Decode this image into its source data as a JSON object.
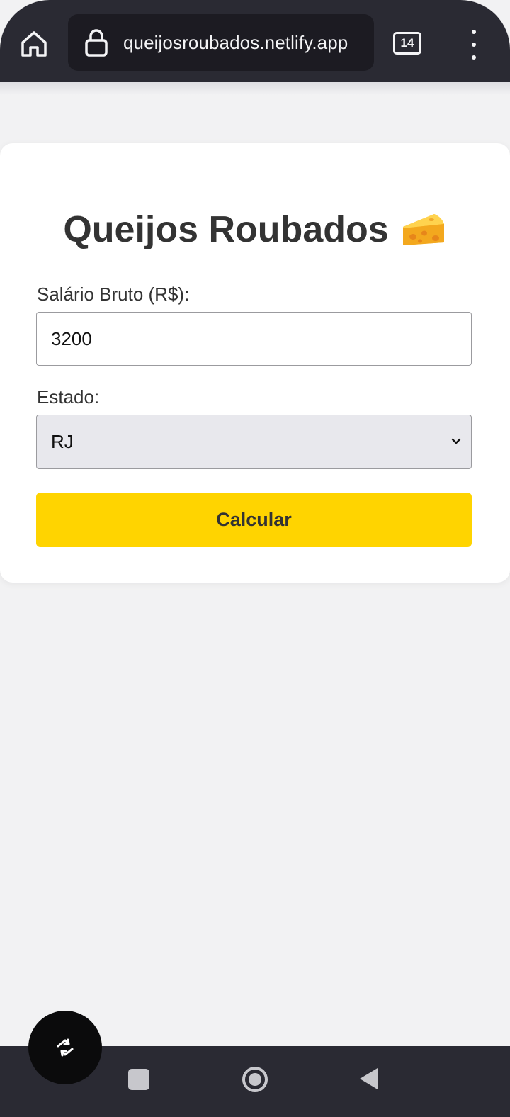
{
  "browser": {
    "url": "queijosroubados.netlify.app",
    "tab_count": "14",
    "icons": {
      "home": "home-icon",
      "lock": "lock-icon",
      "tabs": "tabs-icon",
      "menu": "more-vert-icon"
    }
  },
  "page": {
    "title": "Queijos Roubados",
    "title_icon": "cheese-icon",
    "salario_label": "Salário Bruto (R$):",
    "salario_value": "3200",
    "estado_label": "Estado:",
    "estado_selected": "RJ",
    "submit_label": "Calcular"
  },
  "colors": {
    "accent": "#ffd400",
    "toolbar": "#2a2a33",
    "background": "#f2f2f3"
  },
  "system_nav": {
    "icons": [
      "recents-icon",
      "home-circle-icon",
      "back-icon"
    ],
    "fab_icon": "rotate-screen-icon"
  }
}
